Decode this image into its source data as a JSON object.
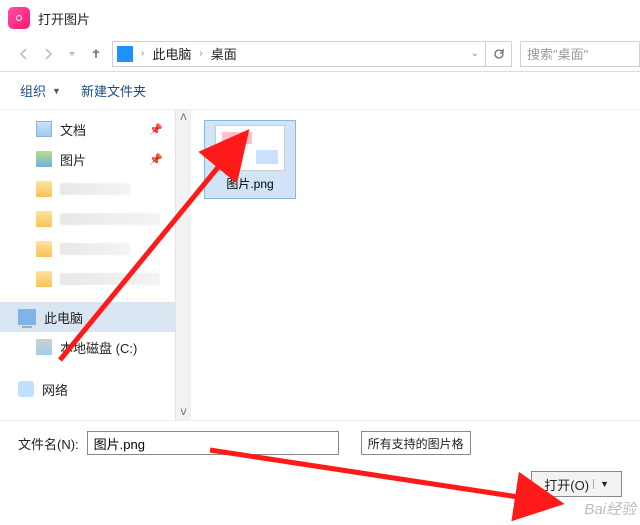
{
  "title": "打开图片",
  "breadcrumb": {
    "root": "此电脑",
    "leaf": "桌面"
  },
  "search_placeholder": "搜索\"桌面\"",
  "toolbar": {
    "organize": "组织",
    "new_folder": "新建文件夹"
  },
  "sidebar": {
    "documents": "文档",
    "pictures": "图片",
    "this_pc": "此电脑",
    "local_disk": "本地磁盘 (C:)",
    "network": "网络"
  },
  "file": {
    "name": "图片.png"
  },
  "bottom": {
    "filename_label": "文件名(N):",
    "filename_value": "图片.png",
    "filter_label": "所有支持的图片格",
    "open": "打开(O)"
  },
  "watermark": "Bai经验"
}
